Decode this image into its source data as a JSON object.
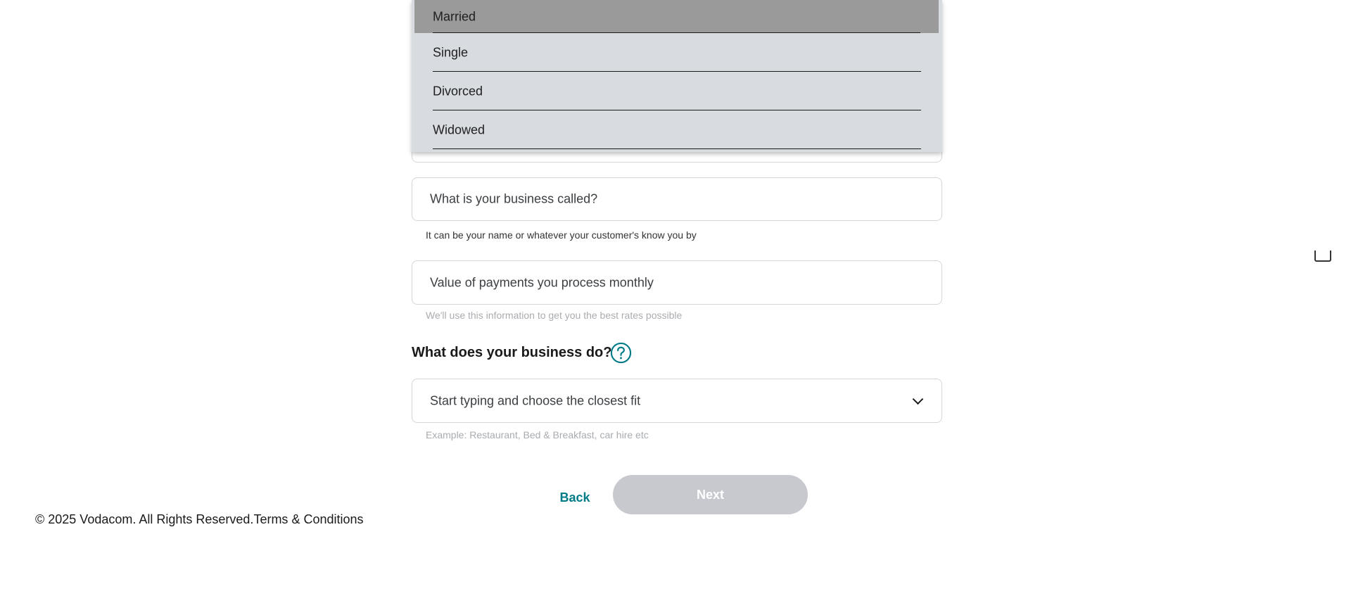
{
  "marital_status": {
    "options": [
      {
        "label": "Married",
        "selected": true
      },
      {
        "label": "Single",
        "selected": false
      },
      {
        "label": "Divorced",
        "selected": false
      },
      {
        "label": "Widowed",
        "selected": false
      }
    ]
  },
  "business_name": {
    "placeholder": "What is your business called?",
    "hint": "It can be your name or whatever your customer's know you by"
  },
  "monthly_payments": {
    "placeholder": "Value of payments you process monthly",
    "hint": "We'll use this information to get you the best rates possible"
  },
  "business_type": {
    "heading": "What does your business do?",
    "placeholder": "Start typing and choose the closest fit",
    "hint": "Example: Restaurant, Bed & Breakfast, car hire etc"
  },
  "actions": {
    "back_label": "Back",
    "next_label": "Next"
  },
  "footer": {
    "copyright": "© 2025 Vodacom. All Rights Reserved.",
    "terms_link": "Terms & Conditions"
  },
  "colors": {
    "accent": "#007c89",
    "next_disabled": "#c7c9cf",
    "dropdown_bg": "#d8dbdf",
    "selected_option": "#9a9a9a"
  }
}
